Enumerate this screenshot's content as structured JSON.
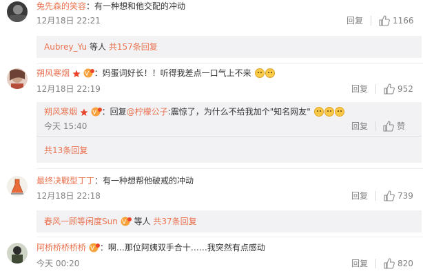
{
  "comments": [
    {
      "user": "兔先森的笑容",
      "text": "：有一种想和他交配的冲动",
      "time": "12月18日 22:21",
      "reply": "回复",
      "likes": "1166",
      "sub": {
        "user": "Aubrey_Yu",
        "suffix": " 等人",
        "count": "共157条回复"
      }
    },
    {
      "user": "朔风寒烟",
      "text": "：妈蛋词好长！！听得我差点一口气上不来",
      "time": "12月18日 22:19",
      "reply": "回复",
      "likes": "952",
      "reply_item": {
        "user": "朔风寒烟",
        "prefix": "：回复",
        "mention": "@柠檬公子",
        "text": ":震惊了，为什么不给我加个\"知名网友\"",
        "time": "今天 15:40",
        "reply": "回复",
        "likes": "赞"
      },
      "more": "共13条回复"
    },
    {
      "user": "最终决戰型丁丁",
      "text": "：有一种想帮他破戒的冲动",
      "time": "12月18日 22:18",
      "reply": "回复",
      "likes": "739",
      "sub": {
        "user": "春风一顾等闲度Sun",
        "suffix": " 等人",
        "count": "共37条回复"
      }
    },
    {
      "user": "阿桥桥桥桥桥",
      "text": "：啊…那位阿姨双手合十……我突然有点感动",
      "time": "今天 00:20",
      "reply": "回复",
      "likes": "820"
    }
  ],
  "icons": [
    "like-thumb-icon",
    "vip-badge-icon",
    "emoji-icon",
    "star-icon"
  ],
  "colors": {
    "username": "#eb7350",
    "muted": "#808080",
    "subbox_bg": "#f2f2f5"
  }
}
